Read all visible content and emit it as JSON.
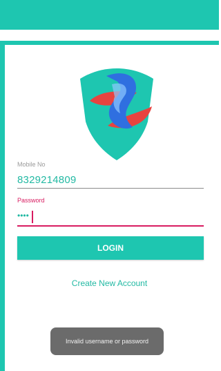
{
  "form": {
    "mobile_label": "Mobile No",
    "mobile_value": "8329214809",
    "password_label": "Password",
    "password_value": "••••"
  },
  "actions": {
    "login_label": "LOGIN",
    "create_account_label": "Create New Account"
  },
  "toast": {
    "message": "Invalid username or password"
  },
  "colors": {
    "primary": "#1ec6b0",
    "accent": "#d81b60",
    "logo_red": "#e8433f",
    "logo_blue": "#2f6fe0"
  }
}
